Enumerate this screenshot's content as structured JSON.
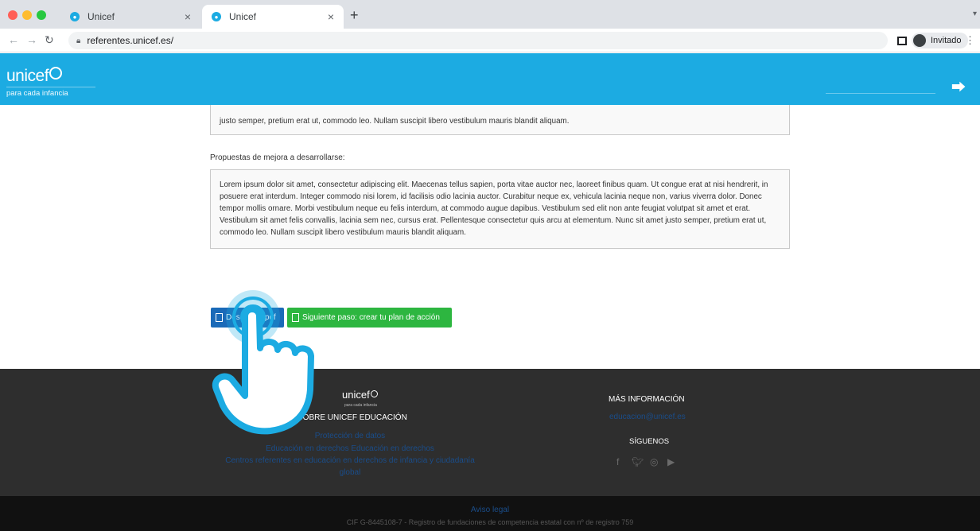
{
  "browser": {
    "tabs": [
      {
        "title": "Unicef",
        "active": false
      },
      {
        "title": "Unicef",
        "active": true
      }
    ],
    "new_tab": "+",
    "url": "referentes.unicef.es/",
    "profile_label": "Invitado"
  },
  "header": {
    "logo_text": "unicef",
    "tagline": "para cada infancia",
    "logout_icon": "logout-icon",
    "brand_color": "#1cabe2"
  },
  "main": {
    "box1_text": "justo semper, pretium erat ut, commodo leo. Nullam suscipit libero vestibulum mauris blandit aliquam.",
    "section_label": "Propuestas de mejora a desarrollarse:",
    "box2_text": "Lorem ipsum dolor sit amet, consectetur adipiscing elit. Maecenas tellus sapien, porta vitae auctor nec, laoreet finibus quam. Ut congue erat at nisi hendrerit, in posuere erat interdum. Integer commodo nisi lorem, id facilisis odio lacinia auctor. Curabitur neque ex, vehicula lacinia neque non, varius viverra dolor. Donec tempor mollis ornare. Morbi vestibulum neque eu felis interdum, at commodo augue dapibus. Vestibulum sed elit non ante feugiat volutpat sit amet et erat. Vestibulum sit amet felis convallis, lacinia sem nec, cursus erat. Pellentesque consectetur quis arcu at elementum. Nunc sit amet justo semper, pretium erat ut, commodo leo. Nullam suscipit libero vestibulum mauris blandit aliquam.",
    "pdf_button_label": "Descargar pdf",
    "next_button_label": "Siguiente paso: crear tu plan de acción"
  },
  "footer": {
    "logo_text": "unicef",
    "logo_tagline": "para cada infancia",
    "about_heading": "SOBRE UNICEF EDUCACIÓN",
    "links": [
      "Protección de datos",
      "Educación en derechos Educación en derechos",
      "Centros referentes en educación en derechos de infancia y ciudadanía",
      "global"
    ],
    "more_info_heading": "MÁS INFORMACIÓN",
    "email": "educacion@unicef.es",
    "follow_heading": "SÍGUENOS",
    "social_icons": [
      "facebook-icon",
      "twitter-icon",
      "instagram-icon",
      "youtube-icon"
    ],
    "legal_link": "Aviso legal",
    "cif_text": "CIF G-8445108-7 - Registro de fundaciones de competencia estatal con nº de registro 759"
  }
}
